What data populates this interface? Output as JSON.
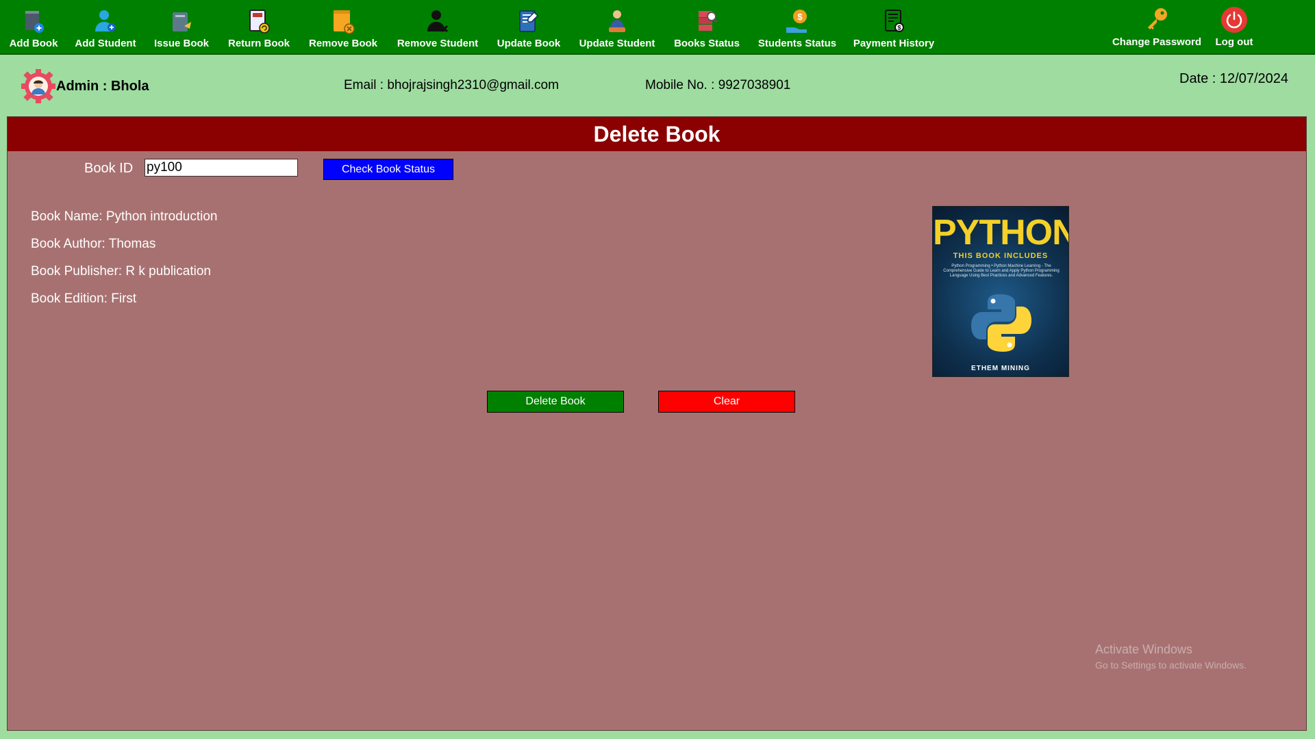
{
  "toolbar": {
    "items": [
      {
        "label": "Add Book",
        "icon": "add-book-icon"
      },
      {
        "label": "Add Student",
        "icon": "add-student-icon"
      },
      {
        "label": "Issue Book",
        "icon": "issue-book-icon"
      },
      {
        "label": "Return Book",
        "icon": "return-book-icon"
      },
      {
        "label": "Remove Book",
        "icon": "remove-book-icon"
      },
      {
        "label": "Remove Student",
        "icon": "remove-student-icon"
      },
      {
        "label": "Update Book",
        "icon": "update-book-icon"
      },
      {
        "label": "Update Student",
        "icon": "update-student-icon"
      },
      {
        "label": "Books Status",
        "icon": "books-status-icon"
      },
      {
        "label": "Students Status",
        "icon": "students-status-icon"
      },
      {
        "label": "Payment History",
        "icon": "payment-history-icon"
      }
    ],
    "change_password": {
      "label": "Change Password",
      "icon": "key-icon"
    },
    "logout": {
      "label": "Log out",
      "icon": "power-icon"
    }
  },
  "admin": {
    "name": "Admin : Bhola",
    "email": "Email : bhojrajsingh2310@gmail.com",
    "mobile": "Mobile No. : 9927038901",
    "date": "Date : 12/07/2024"
  },
  "panel": {
    "title": "Delete Book",
    "book_id_label": "Book ID",
    "book_id_value": "py100",
    "check_button": "Check Book Status",
    "book_name": "Book Name: Python introduction",
    "book_author": "Book Author: Thomas",
    "book_publisher": "Book Publisher: R k publication",
    "book_edition": "Book Edition: First",
    "cover": {
      "title": "PYTHON",
      "subtitle": "THIS BOOK INCLUDES",
      "description": "Python Programming • Python Machine Learning - The Comprehensive Guide to Learn and Apply Python Programming Language Using Best Practices and Advanced Features.",
      "author": "ETHEM MINING"
    },
    "delete_button": "Delete Book",
    "clear_button": "Clear"
  },
  "watermark": {
    "title": "Activate Windows",
    "subtitle": "Go to Settings to activate Windows."
  },
  "colors": {
    "toolbar": "#008000",
    "background": "#9edca0",
    "panel": "#a87171",
    "header": "#8b0000",
    "check_button": "#0000ff",
    "delete_button": "#008000",
    "clear_button": "#ff0000"
  }
}
